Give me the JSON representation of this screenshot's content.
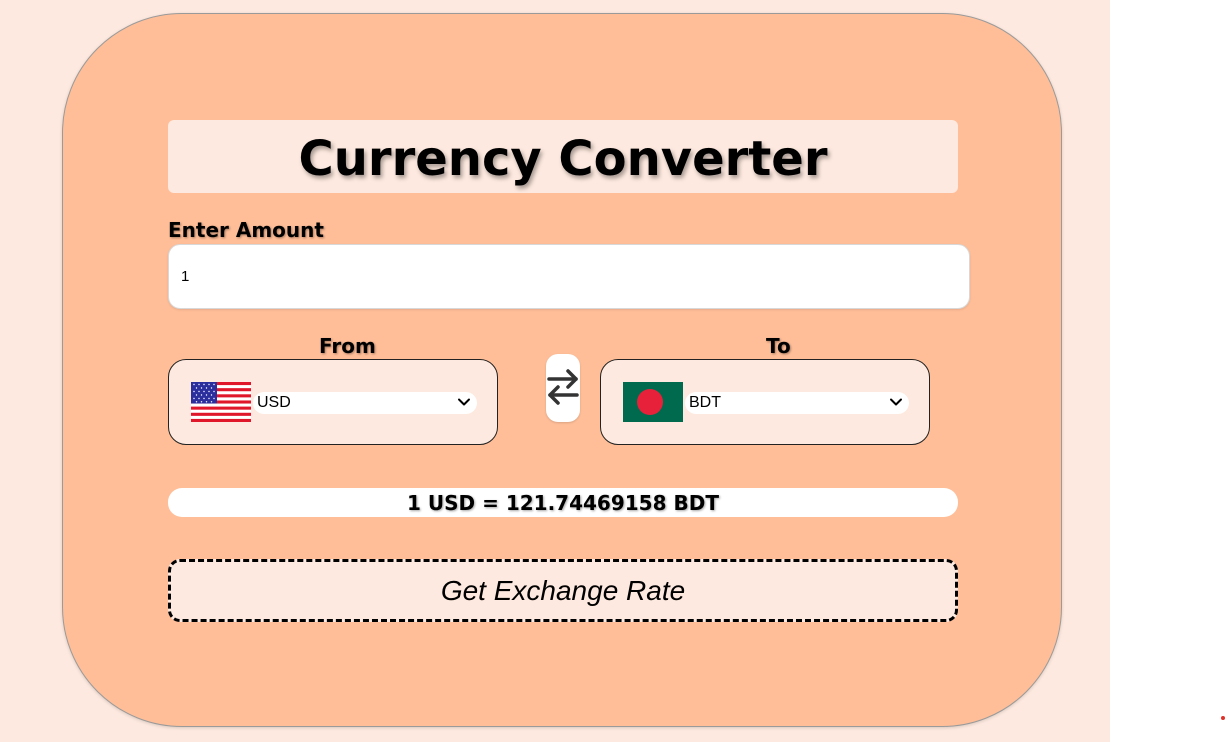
{
  "app": {
    "title": "Currency Converter"
  },
  "amount": {
    "label": "Enter Amount",
    "value": "1"
  },
  "from": {
    "label": "From",
    "currency": "USD",
    "flag_icon": "us-flag-icon"
  },
  "to": {
    "label": "To",
    "currency": "BDT",
    "flag_icon": "bd-flag-icon"
  },
  "swap": {
    "icon": "swap-arrows-icon"
  },
  "result": {
    "text": "1 USD = 121.74469158 BDT"
  },
  "action": {
    "label": "Get Exchange Rate"
  },
  "colors": {
    "page_bg": "#fde9df",
    "card_bg": "#ffbe98",
    "field_bg": "#fde9df",
    "text": "#000000"
  }
}
